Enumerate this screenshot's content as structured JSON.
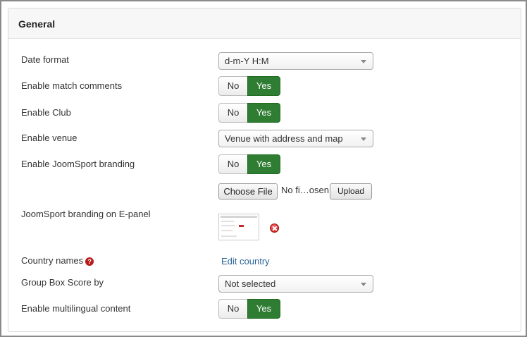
{
  "panel": {
    "title": "General"
  },
  "rows": {
    "date_format": {
      "label": "Date format",
      "value": "d-m-Y H:M"
    },
    "match_comments": {
      "label": "Enable match comments",
      "no": "No",
      "yes": "Yes",
      "selected": "Yes"
    },
    "club": {
      "label": "Enable Club",
      "no": "No",
      "yes": "Yes",
      "selected": "Yes"
    },
    "venue": {
      "label": "Enable venue",
      "value": "Venue with address and map"
    },
    "branding": {
      "label": "Enable JoomSport branding",
      "no": "No",
      "yes": "Yes",
      "selected": "Yes"
    },
    "file": {
      "choose_label": "Choose File",
      "status": "No fi…osen",
      "upload_label": "Upload"
    },
    "branding_epanel": {
      "label": "JoomSport branding on E-panel",
      "thumbnail_icon": "branding-thumbnail",
      "delete_icon": "delete-icon"
    },
    "country": {
      "label": "Country names",
      "help_icon": "?",
      "link": "Edit country"
    },
    "group_box": {
      "label": "Group Box Score by",
      "value": "Not selected"
    },
    "multilingual": {
      "label": "Enable multilingual content",
      "no": "No",
      "yes": "Yes",
      "selected": "Yes"
    }
  },
  "colors": {
    "accent_green": "#2f7d32",
    "link_blue": "#2a6496",
    "help_red": "#b71c1c"
  }
}
